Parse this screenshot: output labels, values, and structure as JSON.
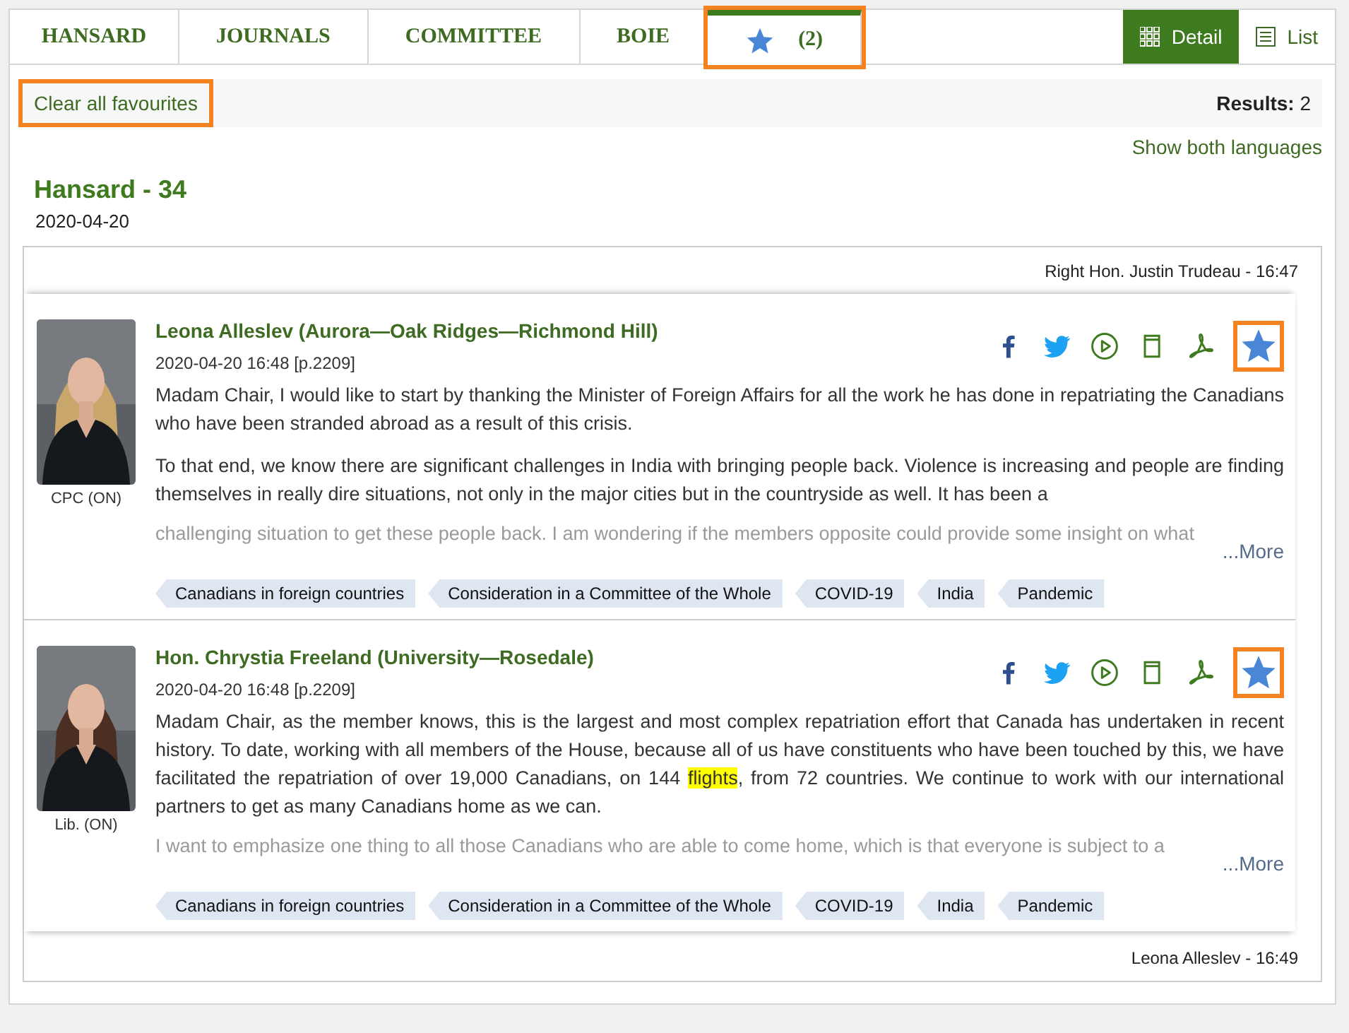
{
  "tabs": [
    {
      "kind": "text",
      "label": "HANSARD",
      "selected": false,
      "highlighted": false
    },
    {
      "kind": "text",
      "label": "JOURNALS",
      "selected": false,
      "highlighted": false
    },
    {
      "kind": "text",
      "label": "COMMITTEE",
      "selected": false,
      "highlighted": false
    },
    {
      "kind": "text",
      "label": "BOIE",
      "selected": false,
      "highlighted": false
    },
    {
      "kind": "favourites",
      "label": "(2)",
      "selected": true,
      "highlighted": true
    }
  ],
  "view_toggle": [
    {
      "label": "Detail",
      "selected": true
    },
    {
      "label": "List",
      "selected": false
    }
  ],
  "toolbar": {
    "clear_link": {
      "label": "Clear all favourites",
      "highlighted": true
    },
    "results": "**Results:** 2"
  },
  "language_link": "Show both languages",
  "section": {
    "title": "Hansard - 34",
    "date": "2020-04-20"
  },
  "previous_speaker": "Right Hon. Justin Trudeau - 16:47",
  "entries": [
    {
      "speaker": "Leona Alleslev (Aurora—Oak Ridges—Richmond Hill)",
      "affiliation": "CPC (ON)",
      "timestamp": "2020-04-20 16:48 [p.2209]",
      "paragraphs": [
        {
          "segments": [
            {
              "text": "Madam Chair, I would like to start by thanking the Minister of Foreign Affairs for all the work he has done in repatriating the Canadians who have been stranded abroad as a result of this crisis.",
              "highlight": false
            }
          ]
        },
        {
          "segments": [
            {
              "text": "To that end, we know there are significant challenges in India with bringing people back. Violence is increasing and people are finding themselves in really dire situations, not only in the major cities but in the countryside as well. It has been a",
              "highlight": false
            }
          ]
        }
      ],
      "faded_line": "challenging situation to get these people back. I am wondering if the members opposite could provide some insight on what",
      "more": "...More",
      "tags": [
        "Canadians in foreign countries",
        "Consideration in a Committee of the Whole",
        "COVID-19",
        "India",
        "Pandemic"
      ],
      "favourite": {
        "selected": true,
        "highlighted": true
      }
    },
    {
      "speaker": "Hon. Chrystia Freeland (University—Rosedale)",
      "affiliation": "Lib. (ON)",
      "timestamp": "2020-04-20 16:48 [p.2209]",
      "paragraphs": [
        {
          "segments": [
            {
              "text": "Madam Chair, as the member knows, this is the largest and most complex repatriation effort that Canada has undertaken in recent history. To date, working with all members of the House, because all of us have constituents who have been touched by this, we have facilitated the repatriation of over 19,000 Canadians, on 144 ",
              "highlight": false
            },
            {
              "text": "flights",
              "highlight": true
            },
            {
              "text": ", from 72 countries. We continue to work with our international partners to get as many Canadians home as we can.",
              "highlight": false
            }
          ]
        }
      ],
      "faded_line": "I want to emphasize one thing to all those Canadians who are able to come home, which is that everyone is subject to a",
      "more": "...More",
      "tags": [
        "Canadians in foreign countries",
        "Consideration in a Committee of the Whole",
        "COVID-19",
        "India",
        "Pandemic"
      ],
      "favourite": {
        "selected": true,
        "highlighted": true
      }
    }
  ],
  "next_speaker": "Leona Alleslev - 16:49"
}
